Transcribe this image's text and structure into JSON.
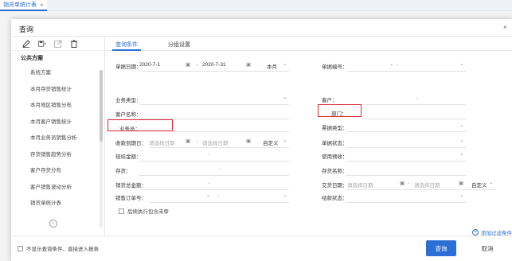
{
  "tab": {
    "label": "销货单统计表",
    "close": "×"
  },
  "dialog": {
    "title": "查询",
    "close": "×"
  },
  "toolbar": {
    "icons": [
      "edit-icon",
      "save-icon",
      "export-icon",
      "delete-icon"
    ]
  },
  "schemes": {
    "header": "公共方案",
    "items": [
      "系统方案",
      "本月存货销售统计",
      "本月地区销售分布",
      "本月客户销售统计",
      "本月业务员销售分析",
      "存货销售趋势分析",
      "客户存货分布",
      "客户销售波动分析",
      "销货单统计表"
    ],
    "collapse": "‹"
  },
  "tabs": {
    "conditions": "查询条件",
    "group": "分组设置"
  },
  "form": {
    "doc_date_label": "单据日期：",
    "doc_date_from": "2020-7-1",
    "doc_date_to": "2020-7-31",
    "doc_date_period": "本月",
    "doc_no_label": "单据编号：",
    "biz_type_label": "业务类型：",
    "customer_label": "客户：",
    "customer_name_label": "客户名称：",
    "dept_label": "部门：",
    "salesman_label": "业务员：",
    "ticket_type_label": "票据类型：",
    "due_date_label": "收款到期日：",
    "date_placeholder": "请选择日期",
    "custom_label": "自定义",
    "doc_status_label": "单据状态：",
    "cash_amount_label": "现结金额：",
    "use_prepay_label": "使用预收：",
    "inventory_label": "存货：",
    "inventory_name_label": "存货名称：",
    "sales_total_label": "销货总金额：",
    "deliver_date_label": "交货日期：",
    "sales_order_label": "销售订单号：",
    "settle_status_label": "结款状态：",
    "dash": "-",
    "chevron": "⌄"
  },
  "options": {
    "include_unreviewed": "后续执行包含未审"
  },
  "add_filter": "添加过滤条件",
  "footer": {
    "no_condition": "不显示查询条件，直接进入报表",
    "query": "查询",
    "cancel": "取消"
  },
  "colors": {
    "accent": "#2b6fd6",
    "highlight": "#d9262c"
  }
}
